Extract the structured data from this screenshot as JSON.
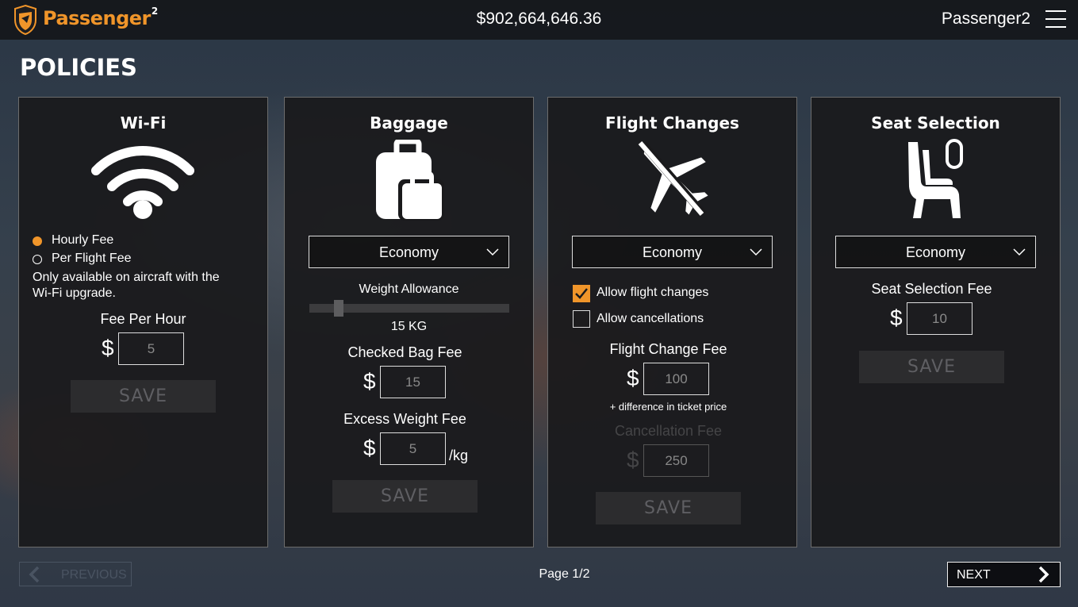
{
  "header": {
    "brand_name": "Passenger",
    "brand_superscript": "2",
    "balance": "$902,664,646.36",
    "username": "Passenger2",
    "menu_icon": "hamburger-menu-icon",
    "brand_color": "#f0952a"
  },
  "page": {
    "title": "POLICIES"
  },
  "wifi": {
    "title": "Wi-Fi",
    "icon": "wifi-icon",
    "options": [
      {
        "label": "Hourly Fee",
        "selected": true
      },
      {
        "label": "Per Flight Fee",
        "selected": false
      }
    ],
    "note_line1": "Only available on aircraft with the",
    "note_line2": "Wi-Fi upgrade.",
    "fee_label": "Fee Per Hour",
    "currency": "$",
    "fee_value": "5",
    "save_label": "SAVE"
  },
  "baggage": {
    "title": "Baggage",
    "icon": "luggage-icon",
    "class_select": "Economy",
    "weight_label": "Weight Allowance",
    "weight_value": "15 KG",
    "weight_slider_fraction": 0.13,
    "checked_label": "Checked Bag Fee",
    "currency": "$",
    "checked_value": "15",
    "excess_label": "Excess Weight Fee",
    "excess_value": "5",
    "excess_unit": "/kg",
    "save_label": "SAVE"
  },
  "flight_changes": {
    "title": "Flight Changes",
    "icon": "airplane-crossed-icon",
    "class_select": "Economy",
    "allow_changes_label": "Allow flight changes",
    "allow_changes_checked": true,
    "allow_cancel_label": "Allow cancellations",
    "allow_cancel_checked": false,
    "change_fee_label": "Flight Change Fee",
    "currency": "$",
    "change_fee_value": "100",
    "change_fee_note": "+ difference in ticket price",
    "cancel_fee_label": "Cancellation Fee",
    "cancel_fee_value": "250",
    "save_label": "SAVE"
  },
  "seat_selection": {
    "title": "Seat Selection",
    "icon": "seat-icon",
    "class_select": "Economy",
    "fee_label": "Seat Selection Fee",
    "currency": "$",
    "fee_value": "10",
    "save_label": "SAVE"
  },
  "footer": {
    "prev_label": "PREVIOUS",
    "page_indicator": "Page 1/2",
    "next_label": "NEXT"
  }
}
